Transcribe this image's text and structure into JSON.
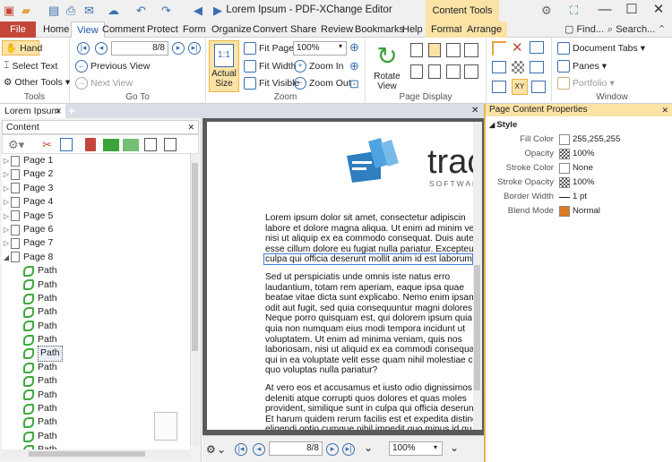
{
  "window": {
    "title": "Lorem Ipsum - PDF-XChange Editor",
    "context_tab": "Content Tools",
    "find": "Find...",
    "search": "Search..."
  },
  "tabs": [
    {
      "label": "File"
    },
    {
      "label": "Home"
    },
    {
      "label": "View"
    },
    {
      "label": "Comment"
    },
    {
      "label": "Protect"
    },
    {
      "label": "Form"
    },
    {
      "label": "Organize"
    },
    {
      "label": "Convert"
    },
    {
      "label": "Share"
    },
    {
      "label": "Review"
    },
    {
      "label": "Bookmarks"
    },
    {
      "label": "Help"
    },
    {
      "label": "Format"
    },
    {
      "label": "Arrange"
    }
  ],
  "ribbon": {
    "tools": {
      "hand": "Hand",
      "select_text": "Select Text",
      "other_tools": "Other Tools",
      "group": "Tools"
    },
    "goto": {
      "page_value": "8/8",
      "previous_view": "Previous View",
      "next_view": "Next View",
      "group": "Go To"
    },
    "zoom": {
      "actual_size_1": "Actual",
      "actual_size_2": "Size",
      "fit_page": "Fit Page",
      "fit_width": "Fit Width",
      "fit_visible": "Fit Visible",
      "zoom_value": "100%",
      "zoom_in": "Zoom In",
      "zoom_out": "Zoom Out",
      "group": "Zoom"
    },
    "page_display": {
      "rotate_1": "Rotate",
      "rotate_2": "View",
      "group": "Page Display"
    },
    "window": {
      "document_tabs": "Document Tabs",
      "panes": "Panes",
      "portfolio": "Portfolio",
      "group": "Window"
    }
  },
  "document_tab": {
    "label": "Lorem Ipsum"
  },
  "content_pane": {
    "title": "Content",
    "items": [
      {
        "label": "Page 1",
        "type": "page"
      },
      {
        "label": "Page 2",
        "type": "page"
      },
      {
        "label": "Page 3",
        "type": "page"
      },
      {
        "label": "Page 4",
        "type": "page"
      },
      {
        "label": "Page 5",
        "type": "page"
      },
      {
        "label": "Page 6",
        "type": "page"
      },
      {
        "label": "Page 7",
        "type": "page"
      },
      {
        "label": "Page 8",
        "type": "page",
        "expanded": true
      },
      {
        "label": "Path",
        "type": "path"
      },
      {
        "label": "Path",
        "type": "path"
      },
      {
        "label": "Path",
        "type": "path"
      },
      {
        "label": "Path",
        "type": "path"
      },
      {
        "label": "Path",
        "type": "path"
      },
      {
        "label": "Path",
        "type": "path"
      },
      {
        "label": "Path",
        "type": "path",
        "selected": true
      },
      {
        "label": "Path",
        "type": "path"
      },
      {
        "label": "Path",
        "type": "path"
      },
      {
        "label": "Path",
        "type": "path"
      },
      {
        "label": "Path",
        "type": "path"
      },
      {
        "label": "Path",
        "type": "path"
      },
      {
        "label": "Path",
        "type": "path"
      },
      {
        "label": "Path",
        "type": "path"
      },
      {
        "label": "Path",
        "type": "path"
      }
    ]
  },
  "document": {
    "logo_text": "trac",
    "logo_sub": "SOFTWAR",
    "paragraph1": [
      "Lorem ipsum dolor sit amet, consectetur adipiscin",
      "labore et dolore magna aliqua. Ut enim ad minim ven",
      "nisi ut aliquip ex ea commodo consequat. Duis aute",
      "esse cillum dolore eu fugiat nulla pariatur. Excepteur",
      "culpa qui officia deserunt mollit anim id est laborum."
    ],
    "paragraph2": [
      "Sed ut perspiciatis unde omnis iste natus erro",
      "laudantium, totam rem aperiam, eaque ipsa quae",
      "beatae vitae dicta sunt explicabo. Nemo enim ipsam",
      "odit aut fugit, sed quia consequuntur magni dolores",
      "Neque porro quisquam est, qui dolorem ipsum quia",
      "quia non numquam eius modi tempora incidunt ut",
      "voluptatem. Ut enim ad minima veniam, quis nos",
      "laboriosam, nisi ut aliquid ex ea commodi consequa",
      "qui in ea voluptate velit esse quam nihil molestiae c",
      "quo voluptas nulla pariatur?"
    ],
    "paragraph3": [
      "At vero eos et accusamus et iusto odio dignissimos d",
      "deleniti atque corrupti quos dolores et quas moles",
      "provident, similique sunt in culpa qui officia deserunt",
      "Et harum quidem rerum facilis est et expedita distinc",
      "eligendi optio cumque nihil impedit quo minus id qu"
    ]
  },
  "status": {
    "page_value": "8/8",
    "zoom_value": "100%"
  },
  "properties": {
    "title": "Page Content Properties",
    "section": "Style",
    "rows": [
      {
        "label": "Fill Color",
        "value": "255,255,255",
        "swatch": "#ffffff"
      },
      {
        "label": "Opacity",
        "value": "100%",
        "swatch": "checker"
      },
      {
        "label": "Stroke Color",
        "value": "None",
        "swatch": "none"
      },
      {
        "label": "Stroke Opacity",
        "value": "100%",
        "swatch": "checker"
      },
      {
        "label": "Border Width",
        "value": "1 pt",
        "swatch": "line"
      },
      {
        "label": "Blend Mode",
        "value": "Normal",
        "swatch": "#e07a1f"
      }
    ]
  }
}
